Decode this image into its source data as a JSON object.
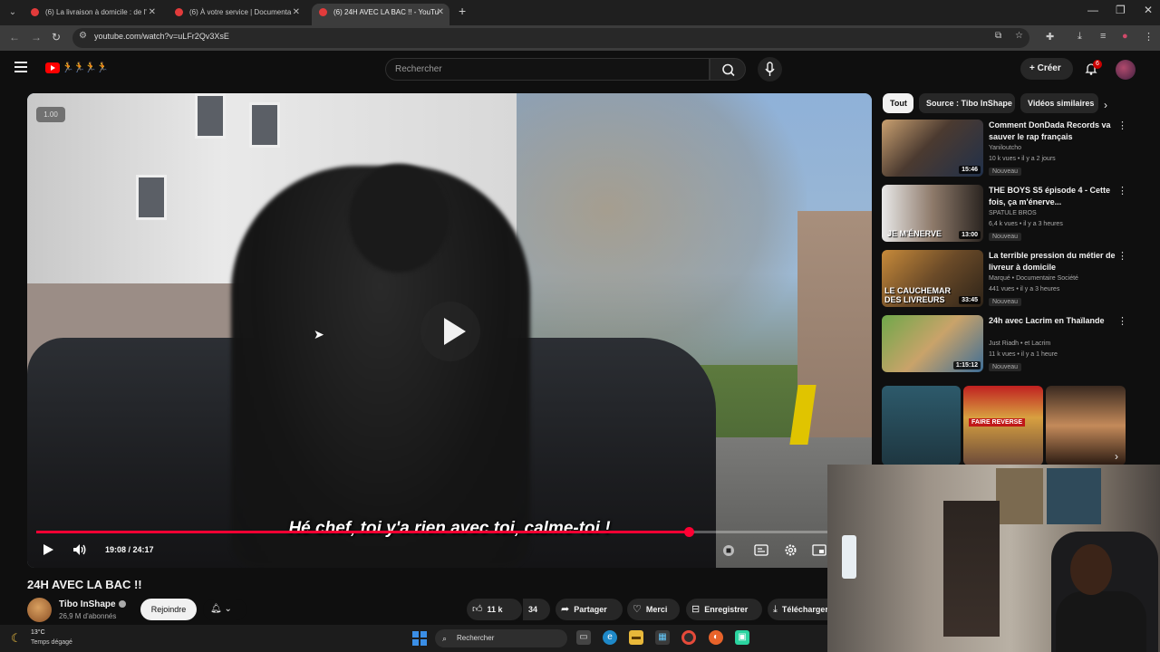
{
  "browser": {
    "tabs": [
      {
        "label": "(6) La livraison à domicile : de l'",
        "active": false
      },
      {
        "label": "(6) À votre service | Documenta",
        "active": false
      },
      {
        "label": "(6) 24H AVEC LA BAC !! - YouTu",
        "active": true
      }
    ],
    "url": "youtube.com/watch?v=uLFr2Qv3XsE"
  },
  "header": {
    "search_placeholder": "Rechercher",
    "create_label": "Créer",
    "notification_count": "6",
    "logo_doodle": "🏃🏃🏃🏃"
  },
  "player": {
    "speed_badge": "1.00",
    "subtitle": "Hé chef, toi y'a rien avec toi, calme-toi !",
    "time": "19:08 / 24:17",
    "progress": 0.79
  },
  "video": {
    "title": "24H AVEC LA BAC !!",
    "channel": "Tibo InShape",
    "subscribers": "26,9 M d'abonnés",
    "join_label": "Rejoindre",
    "likes": "11 k",
    "comments": "34",
    "share_label": "Partager",
    "thanks_label": "Merci",
    "save_label": "Enregistrer",
    "download_label": "Télécharger"
  },
  "sidebar": {
    "chips": [
      "Tout",
      "Source : Tibo InShape",
      "Vidéos similaires"
    ],
    "recommendations": [
      {
        "title": "Comment DonDada Records va sauver le rap français",
        "channel": "Yaniloutcho",
        "meta": "10 k vues • il y a 2 jours",
        "duration": "15:46",
        "badge": "Nouveau"
      },
      {
        "title": "THE BOYS S5 épisode 4 - Cette fois, ça m'énerve...",
        "channel": "SPATULE BROS",
        "meta": "6,4 k vues • il y a 3 heures",
        "duration": "13:00",
        "badge": "Nouveau"
      },
      {
        "title": "La terrible pression du métier de livreur à domicile",
        "channel": "Marqué • Documentaire Société",
        "meta": "441 vues • il y a 3 heures",
        "duration": "33:45",
        "badge": "Nouveau"
      },
      {
        "title": "24h avec Lacrim en Thaïlande",
        "channel": "Just Riadh • et Lacrim",
        "meta": "11 k vues • il y a 1 heure",
        "duration": "1:15:12",
        "badge": "Nouveau"
      }
    ],
    "thumb_texts": [
      "JE M'ÉNERVE",
      "LE CAUCHEMAR DES LIVREURS",
      "FAIRE REVERSE"
    ]
  },
  "taskbar": {
    "temperature": "13°C",
    "weather": "Temps dégagé",
    "search_label": "Rechercher"
  },
  "colors": {
    "accent": "#ff0033",
    "background": "#0f0f0f",
    "chip_active": "#f1f1f1"
  }
}
